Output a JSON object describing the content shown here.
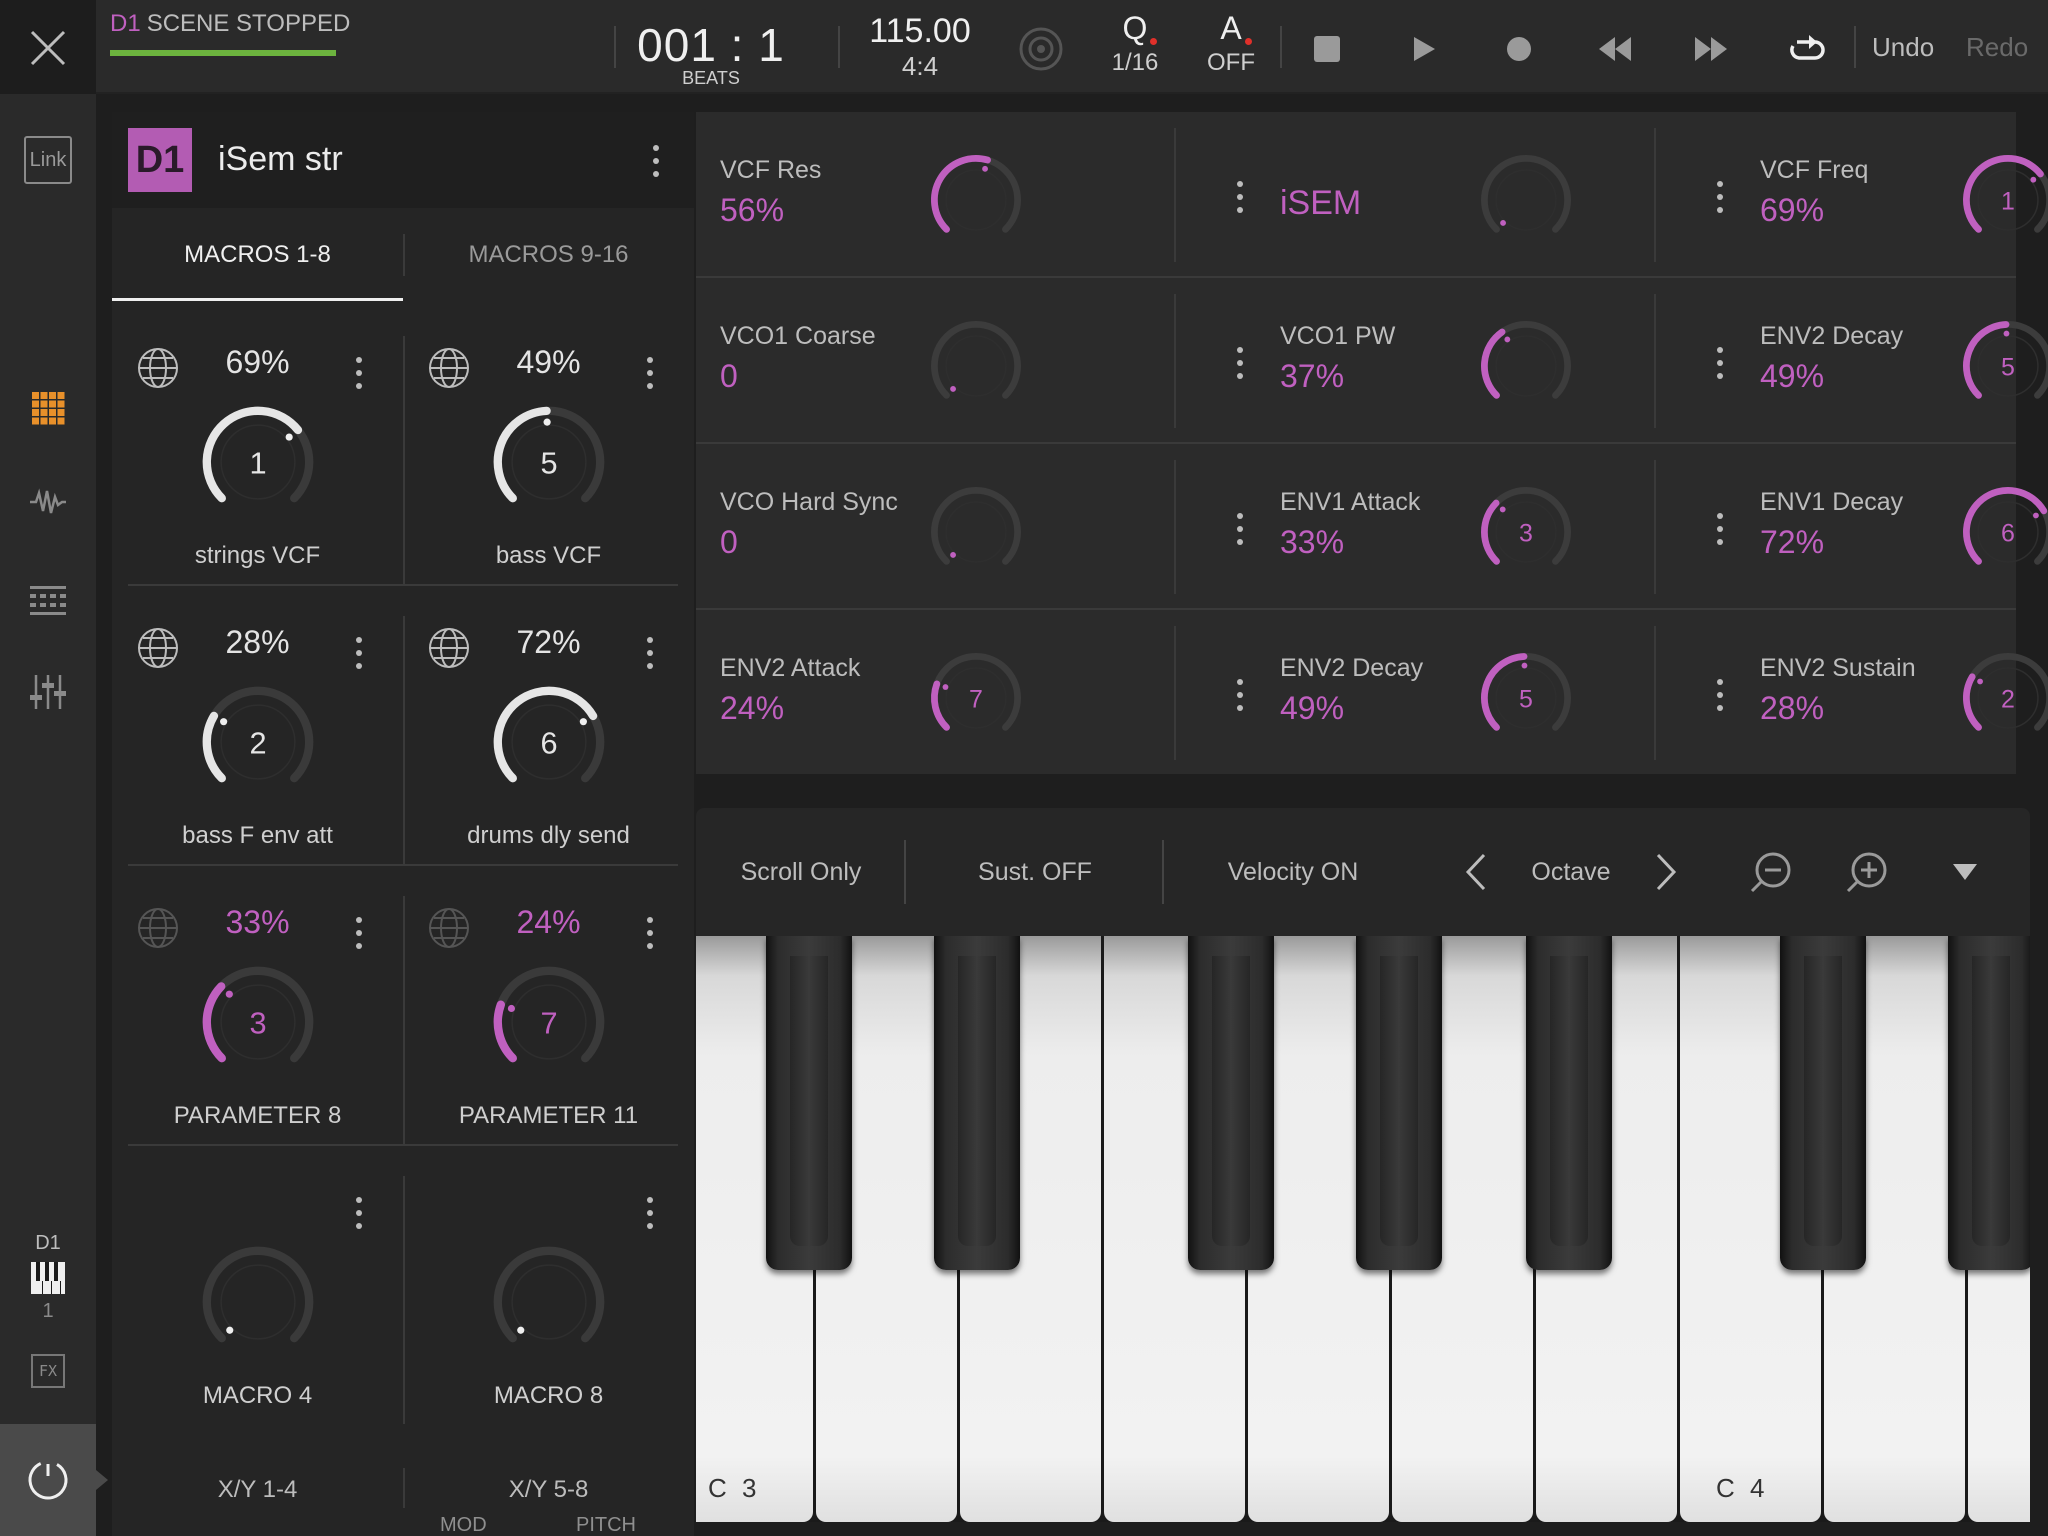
{
  "topbar": {
    "scene_id": "D1",
    "scene_status": "SCENE STOPPED",
    "beats": "001 : 1",
    "beats_label": "BEATS",
    "tempo": "115.00",
    "signature": "4:4",
    "quantize": {
      "letter": "Q",
      "value": "1/16"
    },
    "automation": {
      "letter": "A",
      "value": "OFF"
    },
    "undo": "Undo",
    "redo": "Redo"
  },
  "sidebar": {
    "link": "Link",
    "track_id": "D1",
    "track_num": "1",
    "fx": "FX"
  },
  "track": {
    "badge": "D1",
    "name": "iSem str"
  },
  "macro_tabs": [
    {
      "label": "MACROS 1-8",
      "active": true
    },
    {
      "label": "MACROS 9-16",
      "active": false
    }
  ],
  "macros": [
    {
      "value": "69%",
      "level": 0.69,
      "num": "1",
      "label": "strings VCF",
      "style": "white"
    },
    {
      "value": "49%",
      "level": 0.49,
      "num": "5",
      "label": "bass VCF",
      "style": "white"
    },
    {
      "value": "28%",
      "level": 0.28,
      "num": "2",
      "label": "bass F env att",
      "style": "white"
    },
    {
      "value": "72%",
      "level": 0.72,
      "num": "6",
      "label": "drums dly send",
      "style": "white"
    },
    {
      "value": "33%",
      "level": 0.33,
      "num": "3",
      "label": "PARAMETER 8",
      "style": "pink"
    },
    {
      "value": "24%",
      "level": 0.24,
      "num": "7",
      "label": "PARAMETER 11",
      "style": "pink"
    },
    {
      "value": "",
      "level": 0.0,
      "num": "",
      "label": "MACRO 4",
      "style": "empty"
    },
    {
      "value": "",
      "level": 0.0,
      "num": "",
      "label": "MACRO 8",
      "style": "empty"
    }
  ],
  "xy_tabs": [
    "X/Y 1-4",
    "X/Y 5-8"
  ],
  "bottom_labels": {
    "mod": "MOD",
    "pitch": "PITCH"
  },
  "params": [
    {
      "name": "VCF Res",
      "value": "56%",
      "level": 0.56,
      "num": ""
    },
    {
      "name": "",
      "value": "iSEM",
      "level": 0.0,
      "num": ""
    },
    {
      "name": "VCF Freq",
      "value": "69%",
      "level": 0.69,
      "num": "1"
    },
    {
      "name": "VCO1 Coarse",
      "value": "0",
      "level": 0.0,
      "num": ""
    },
    {
      "name": "VCO1 PW",
      "value": "37%",
      "level": 0.37,
      "num": ""
    },
    {
      "name": "ENV2 Decay",
      "value": "49%",
      "level": 0.49,
      "num": "5"
    },
    {
      "name": "VCO Hard Sync",
      "value": "0",
      "level": 0.0,
      "num": ""
    },
    {
      "name": "ENV1 Attack",
      "value": "33%",
      "level": 0.33,
      "num": "3"
    },
    {
      "name": "ENV1 Decay",
      "value": "72%",
      "level": 0.72,
      "num": "6"
    },
    {
      "name": "ENV2 Attack",
      "value": "24%",
      "level": 0.24,
      "num": "7"
    },
    {
      "name": "ENV2 Decay",
      "value": "49%",
      "level": 0.49,
      "num": "5"
    },
    {
      "name": "ENV2 Sustain",
      "value": "28%",
      "level": 0.28,
      "num": "2"
    }
  ],
  "keyboard_bar": {
    "scroll": "Scroll Only",
    "sustain": "Sust. OFF",
    "velocity": "Velocity ON",
    "octave": "Octave"
  },
  "piano": {
    "label_c3": "C 3",
    "label_c4": "C 4"
  },
  "colors": {
    "accent": "#c060c0",
    "scene_bar": "#6cb33e",
    "record_dot": "#e0302a",
    "grid_icon": "#e8902a"
  }
}
